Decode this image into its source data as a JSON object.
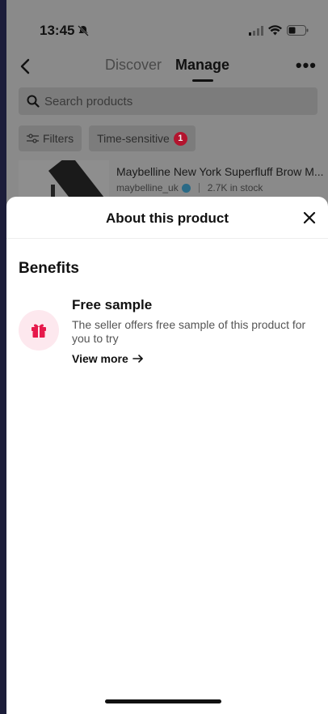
{
  "status_bar": {
    "time": "13:45"
  },
  "nav": {
    "tabs": [
      {
        "label": "Discover",
        "active": false
      },
      {
        "label": "Manage",
        "active": true
      }
    ]
  },
  "search": {
    "placeholder": "Search products"
  },
  "chips": {
    "filters_label": "Filters",
    "time_sensitive_label": "Time-sensitive",
    "time_sensitive_count": "1"
  },
  "product": {
    "title": "Maybelline New York Superfluff Brow M...",
    "seller": "maybelline_uk",
    "stock": "2.7K in stock"
  },
  "sheet": {
    "title": "About this product",
    "section_title": "Benefits",
    "benefit": {
      "title": "Free sample",
      "description": "The seller offers free sample of this product for you to try",
      "link_label": "View more"
    }
  },
  "colors": {
    "brand_accent": "#e6194b",
    "badge_red": "#d61a3c"
  }
}
